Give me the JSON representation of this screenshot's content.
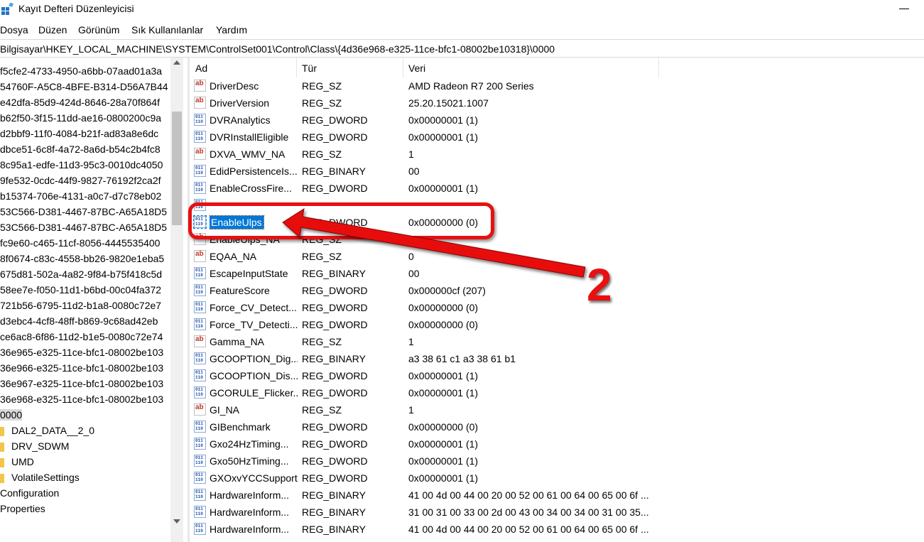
{
  "window": {
    "title": "Kayıt Defteri Düzenleyicisi"
  },
  "menu": [
    "Dosya",
    "Düzen",
    "Görünüm",
    "Sık Kullanılanlar",
    "Yardım"
  ],
  "address": "Bilgisayar\\HKEY_LOCAL_MACHINE\\SYSTEM\\ControlSet001\\Control\\Class\\{4d36e968-e325-11ce-bfc1-08002be10318}\\0000",
  "tree": [
    {
      "label": "f5cfe2-4733-4950-a6bb-07aad01a3a"
    },
    {
      "label": "54760F-A5C8-4BFE-B314-D56A7B44"
    },
    {
      "label": "e42dfa-85d9-424d-8646-28a70f864f"
    },
    {
      "label": "b62f50-3f15-11dd-ae16-0800200c9a"
    },
    {
      "label": "d2bbf9-11f0-4084-b21f-ad83a8e6dc"
    },
    {
      "label": "dbce51-6c8f-4a72-8a6d-b54c2b4fc8"
    },
    {
      "label": "8c95a1-edfe-11d3-95c3-0010dc4050"
    },
    {
      "label": "9fe532-0cdc-44f9-9827-76192f2ca2f"
    },
    {
      "label": "b15374-706e-4131-a0c7-d7c78eb02"
    },
    {
      "label": "53C566-D381-4467-87BC-A65A18D5"
    },
    {
      "label": "53C566-D381-4467-87BC-A65A18D5"
    },
    {
      "label": "fc9e60-c465-11cf-8056-4445535400"
    },
    {
      "label": "8f0674-c83c-4558-bb26-9820e1eba5"
    },
    {
      "label": "675d81-502a-4a82-9f84-b75f418c5d"
    },
    {
      "label": "58ee7e-f050-11d1-b6bd-00c04fa372"
    },
    {
      "label": "721b56-6795-11d2-b1a8-0080c72e7"
    },
    {
      "label": "d3ebc4-4cf8-48ff-b869-9c68ad42eb"
    },
    {
      "label": "ce6ac8-6f86-11d2-b1e5-0080c72e74"
    },
    {
      "label": "36e965-e325-11ce-bfc1-08002be103"
    },
    {
      "label": "36e966-e325-11ce-bfc1-08002be103"
    },
    {
      "label": "36e967-e325-11ce-bfc1-08002be103"
    },
    {
      "label": "36e968-e325-11ce-bfc1-08002be103"
    },
    {
      "label": "0000",
      "selected": true
    },
    {
      "label": "DAL2_DATA__2_0",
      "folder": true
    },
    {
      "label": "DRV_SDWM",
      "folder": true
    },
    {
      "label": "UMD",
      "folder": true
    },
    {
      "label": "VolatileSettings",
      "folder": true
    },
    {
      "label": "Configuration"
    },
    {
      "label": "Properties"
    }
  ],
  "columns": {
    "name": "Ad",
    "type": "Tür",
    "data": "Veri"
  },
  "rows": [
    {
      "name": "DriverDesc",
      "type": "REG_SZ",
      "data": "AMD Radeon R7 200 Series",
      "icon": "ab"
    },
    {
      "name": "DriverVersion",
      "type": "REG_SZ",
      "data": "25.20.15021.1007",
      "icon": "ab"
    },
    {
      "name": "DVRAnalytics",
      "type": "REG_DWORD",
      "data": "0x00000001 (1)",
      "icon": "bin"
    },
    {
      "name": "DVRInstallEligible",
      "type": "REG_DWORD",
      "data": "0x00000001 (1)",
      "icon": "bin"
    },
    {
      "name": "DXVA_WMV_NA",
      "type": "REG_SZ",
      "data": "1",
      "icon": "ab"
    },
    {
      "name": "EdidPersistenceIs...",
      "type": "REG_BINARY",
      "data": "00",
      "icon": "bin"
    },
    {
      "name": "EnableCrossFire...",
      "type": "REG_DWORD",
      "data": "0x00000001 (1)",
      "icon": "bin"
    },
    {
      "name": "",
      "type": "",
      "data": "",
      "icon": "bin"
    },
    {
      "name": "EnableUlps",
      "type": "REG_DWORD",
      "data": "0x00000000 (0)",
      "icon": "bin",
      "selected": true
    },
    {
      "name": "EnableUlps_NA",
      "type": "REG_SZ",
      "data": "",
      "icon": "ab"
    },
    {
      "name": "EQAA_NA",
      "type": "REG_SZ",
      "data": "0",
      "icon": "ab"
    },
    {
      "name": "EscapeInputState",
      "type": "REG_BINARY",
      "data": "00",
      "icon": "bin"
    },
    {
      "name": "FeatureScore",
      "type": "REG_DWORD",
      "data": "0x000000cf (207)",
      "icon": "bin"
    },
    {
      "name": "Force_CV_Detect...",
      "type": "REG_DWORD",
      "data": "0x00000000 (0)",
      "icon": "bin"
    },
    {
      "name": "Force_TV_Detecti...",
      "type": "REG_DWORD",
      "data": "0x00000000 (0)",
      "icon": "bin"
    },
    {
      "name": "Gamma_NA",
      "type": "REG_SZ",
      "data": "1",
      "icon": "ab"
    },
    {
      "name": "GCOOPTION_Dig...",
      "type": "REG_BINARY",
      "data": "a3 38 61 c1 a3 38 61 b1",
      "icon": "bin"
    },
    {
      "name": "GCOOPTION_Dis...",
      "type": "REG_DWORD",
      "data": "0x00000001 (1)",
      "icon": "bin"
    },
    {
      "name": "GCORULE_Flicker...",
      "type": "REG_DWORD",
      "data": "0x00000001 (1)",
      "icon": "bin"
    },
    {
      "name": "GI_NA",
      "type": "REG_SZ",
      "data": "1",
      "icon": "ab"
    },
    {
      "name": "GIBenchmark",
      "type": "REG_DWORD",
      "data": "0x00000000 (0)",
      "icon": "bin"
    },
    {
      "name": "Gxo24HzTiming...",
      "type": "REG_DWORD",
      "data": "0x00000001 (1)",
      "icon": "bin"
    },
    {
      "name": "Gxo50HzTiming...",
      "type": "REG_DWORD",
      "data": "0x00000001 (1)",
      "icon": "bin"
    },
    {
      "name": "GXOxvYCCSupport",
      "type": "REG_DWORD",
      "data": "0x00000001 (1)",
      "icon": "bin"
    },
    {
      "name": "HardwareInform...",
      "type": "REG_BINARY",
      "data": "41 00 4d 00 44 00 20 00 52 00 61 00 64 00 65 00 6f ...",
      "icon": "bin"
    },
    {
      "name": "HardwareInform...",
      "type": "REG_BINARY",
      "data": "31 00 31 00 33 00 2d 00 43 00 34 00 34 00 31 00 35...",
      "icon": "bin"
    },
    {
      "name": "HardwareInform...",
      "type": "REG_BINARY",
      "data": "41 00 4d 00 44 00 20 00 52 00 61 00 64 00 65 00 6f ...",
      "icon": "bin"
    }
  ],
  "annotation": {
    "number": "2",
    "color": "#e81010"
  },
  "colors": {
    "selection": "#0078d7",
    "annotation": "#e81010"
  }
}
